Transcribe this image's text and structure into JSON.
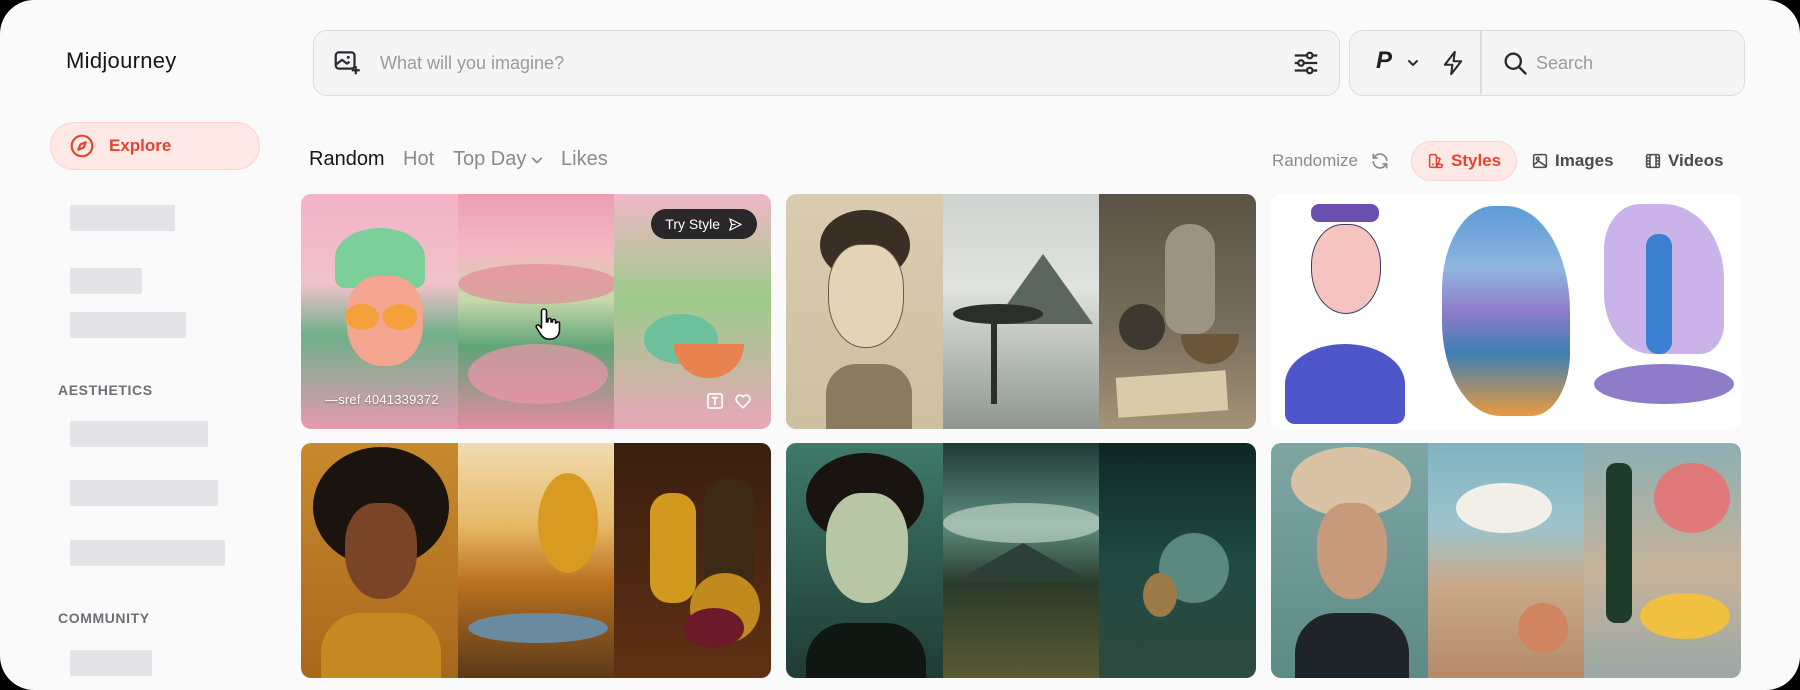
{
  "app": {
    "logo": "Midjourney"
  },
  "sidebar": {
    "explore_label": "Explore",
    "sections": [
      {
        "label": "AESTHETICS"
      },
      {
        "label": "COMMUNITY"
      }
    ]
  },
  "prompt": {
    "placeholder": "What will you imagine?"
  },
  "tools": {
    "personalize_label": "P",
    "search_placeholder": "Search"
  },
  "tabs": [
    {
      "label": "Random",
      "active": true
    },
    {
      "label": "Hot",
      "active": false
    },
    {
      "label": "Top Day",
      "active": false,
      "dropdown": true
    },
    {
      "label": "Likes",
      "active": false
    }
  ],
  "filters": {
    "randomize_label": "Randomize",
    "styles_label": "Styles",
    "images_label": "Images",
    "videos_label": "Videos",
    "active": "Styles"
  },
  "cards": [
    {
      "try_style_label": "Try Style",
      "sref": "—sref 4041339372"
    }
  ],
  "colors": {
    "accent": "#e2452f",
    "accent_bg": "#ffe9e6"
  }
}
